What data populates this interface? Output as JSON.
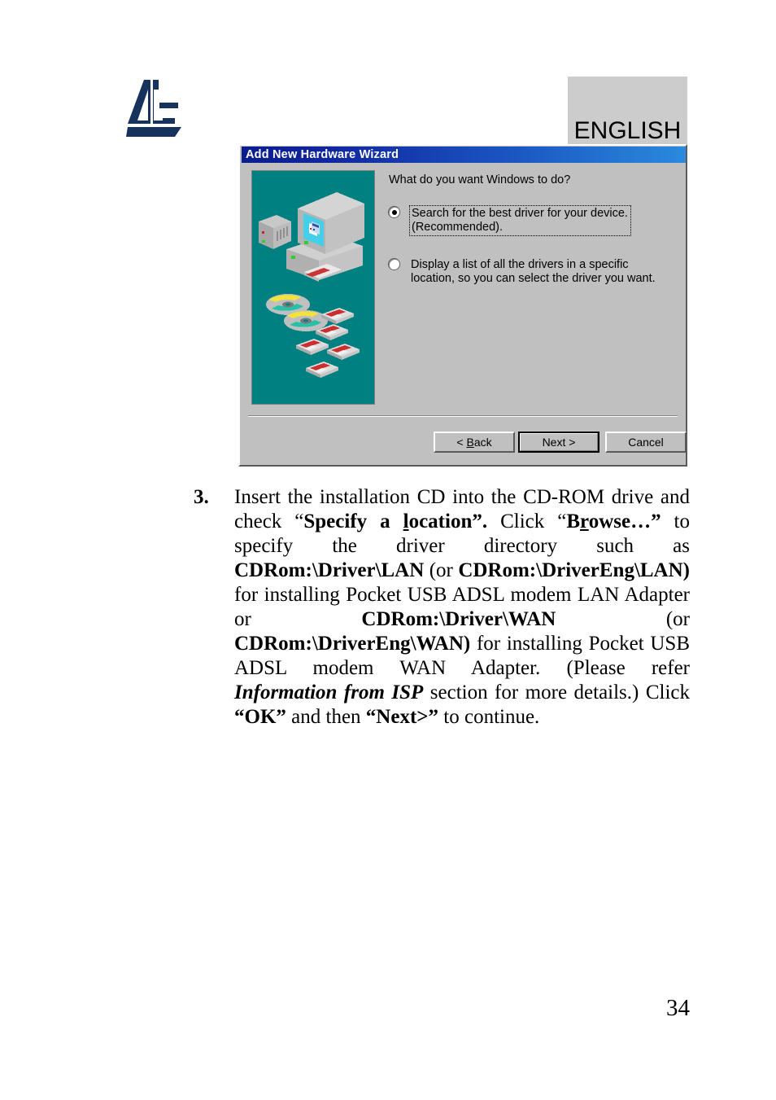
{
  "page": {
    "language_label": "ENGLISH",
    "page_number": "34",
    "logo_name": "atlantis-land-logo"
  },
  "dialog": {
    "title": "Add New Hardware Wizard",
    "question": "What do you want Windows to do?",
    "options": [
      {
        "id": "search-best-driver",
        "line1": "Search for the best driver for your device.",
        "line2": "(Recommended).",
        "selected": true,
        "focused": true
      },
      {
        "id": "display-driver-list",
        "line1": "Display a list of all the drivers in a specific",
        "line2": "location, so you can select the driver you want.",
        "selected": false,
        "focused": false
      }
    ],
    "buttons": {
      "back": "< Back",
      "back_mnemonic": "B",
      "next": "Next >",
      "cancel": "Cancel"
    },
    "illustration": {
      "name": "computer-and-media-illustration",
      "background_color": "#008080"
    },
    "colors": {
      "titlebar_start": "#0a1d8f",
      "titlebar_end": "#2a8ade",
      "face": "#c0c0c0"
    }
  },
  "step": {
    "number": "3.",
    "parts": [
      {
        "text": "Insert the installation CD into the CD-ROM drive and check “",
        "style": "normal"
      },
      {
        "text": "Specify a ",
        "style": "bold"
      },
      {
        "text": "l",
        "style": "bold-underline"
      },
      {
        "text": "ocation”.",
        "style": "bold"
      },
      {
        "text": " Click “",
        "style": "normal"
      },
      {
        "text": "B",
        "style": "bold"
      },
      {
        "text": "r",
        "style": "bold-underline"
      },
      {
        "text": "owse…”",
        "style": "bold"
      },
      {
        "text": " to specify the driver directory such as ",
        "style": "normal"
      },
      {
        "text": "CDRom:\\Driver\\LAN",
        "style": "bold"
      },
      {
        "text": " (or ",
        "style": "normal"
      },
      {
        "text": "CDRom:\\DriverEng\\LAN)",
        "style": "bold"
      },
      {
        "text": " for installing Pocket USB ADSL modem LAN Adapter or ",
        "style": "normal"
      },
      {
        "text": "CDRom:\\Driver\\WAN",
        "style": "bold"
      },
      {
        "text": " (or ",
        "style": "normal"
      },
      {
        "text": "CDRom:\\DriverEng\\WAN)",
        "style": "bold"
      },
      {
        "text": " for installing Pocket USB ADSL modem WAN Adapter. (Please refer ",
        "style": "normal"
      },
      {
        "text": "Information from ISP",
        "style": "bold-italic"
      },
      {
        "text": " section for more details.) Click ",
        "style": "normal"
      },
      {
        "text": "“OK”",
        "style": "bold"
      },
      {
        "text": " and then ",
        "style": "normal"
      },
      {
        "text": "“Next>”",
        "style": "bold"
      },
      {
        "text": " to continue.",
        "style": "normal"
      }
    ]
  }
}
